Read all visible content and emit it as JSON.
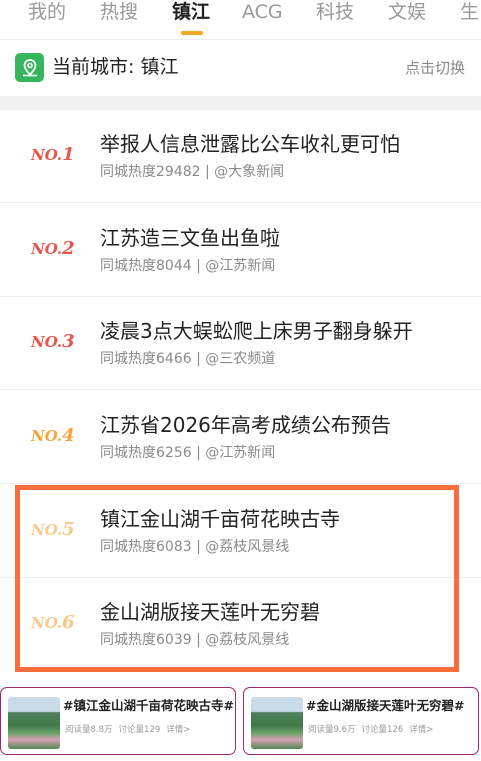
{
  "tabs": [
    {
      "label": "我的",
      "active": false
    },
    {
      "label": "热搜",
      "active": false
    },
    {
      "label": "镇江",
      "active": true
    },
    {
      "label": "ACG",
      "active": false
    },
    {
      "label": "科技",
      "active": false
    },
    {
      "label": "文娱",
      "active": false
    },
    {
      "label": "生",
      "active": false
    }
  ],
  "city_bar": {
    "icon": "location-pin-icon",
    "label": "当前城市: 镇江",
    "switch_label": "点击切换"
  },
  "list": [
    {
      "rank_prefix": "NO.",
      "rank": "1",
      "title": "举报人信息泄露比公车收礼更可怕",
      "meta": "同城热度29482 | @大象新闻"
    },
    {
      "rank_prefix": "NO.",
      "rank": "2",
      "title": "江苏造三文鱼出鱼啦",
      "meta": "同城热度8044 | @江苏新闻"
    },
    {
      "rank_prefix": "NO.",
      "rank": "3",
      "title": "凌晨3点大蜈蚣爬上床男子翻身躲开",
      "meta": "同城热度6466 | @三农频道"
    },
    {
      "rank_prefix": "NO.",
      "rank": "4",
      "title": "江苏省2026年高考成绩公布预告",
      "meta": "同城热度6256 | @江苏新闻"
    },
    {
      "rank_prefix": "NO.",
      "rank": "5",
      "title": "镇江金山湖千亩荷花映古寺",
      "meta": "同城热度6083 | @荔枝风景线"
    },
    {
      "rank_prefix": "NO.",
      "rank": "6",
      "title": "金山湖版接天莲叶无穷碧",
      "meta": "同城热度6039 | @荔枝风景线"
    }
  ],
  "cards": [
    {
      "title": "#镇江金山湖千亩荷花映古寺#",
      "reads": "阅读量8.8万",
      "comments": "讨论量129",
      "detail": "详情>"
    },
    {
      "title": "#金山湖版接天莲叶无穷碧#",
      "reads": "阅读量9.6万",
      "comments": "讨论量126",
      "detail": "详情>"
    }
  ],
  "colors": {
    "accent": "#f5a623",
    "highlight": "#fb6e3c",
    "rank_top": "#e8564a",
    "rank_mid": "#f3a53b",
    "rank_low": "#f7c98a",
    "location_icon_bg": "#35b55c",
    "card_border": "#9c2a6c"
  }
}
